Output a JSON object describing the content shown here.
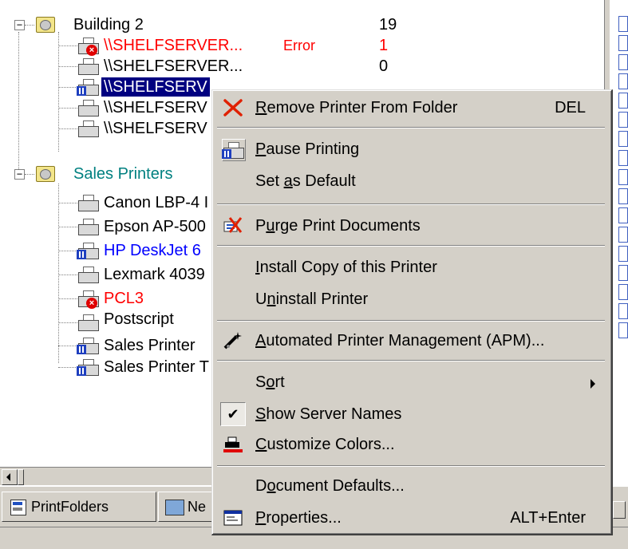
{
  "tree": {
    "building2": {
      "label": "Building 2",
      "count": "19"
    },
    "b2_items": [
      {
        "label": "\\\\SHELFSERVER...",
        "status": "Error",
        "count": "1"
      },
      {
        "label": "\\\\SHELFSERVER...",
        "status": "",
        "count": "0"
      },
      {
        "label": "\\\\SHELFSERV"
      },
      {
        "label": "\\\\SHELFSERV"
      },
      {
        "label": "\\\\SHELFSERV"
      }
    ],
    "sales_printers": {
      "label": "Sales Printers"
    },
    "sales_items": [
      {
        "label": "Canon LBP-4 I"
      },
      {
        "label": "Epson AP-500"
      },
      {
        "label": "HP DeskJet 6"
      },
      {
        "label": "Lexmark 4039"
      },
      {
        "label": "PCL3"
      },
      {
        "label": "Postscript"
      },
      {
        "label": "Sales Printer"
      },
      {
        "label": "Sales Printer T"
      }
    ]
  },
  "tabs": {
    "printfolders": "PrintFolders",
    "network": "Ne"
  },
  "menu": {
    "remove": {
      "pre": "",
      "acc": "R",
      "post": "emove Printer From Folder",
      "shortcut": "DEL"
    },
    "pause": {
      "pre": "",
      "acc": "P",
      "post": "ause Printing"
    },
    "setdefault": {
      "pre": "Set ",
      "acc": "a",
      "post": "s Default"
    },
    "purge": {
      "pre": "P",
      "acc": "u",
      "post": "rge Print Documents"
    },
    "install": {
      "pre": "",
      "acc": "I",
      "post": "nstall Copy of this Printer"
    },
    "uninstall": {
      "pre": "U",
      "acc": "n",
      "post": "install Printer"
    },
    "apm": {
      "pre": "",
      "acc": "A",
      "post": "utomated Printer Management (APM)..."
    },
    "sort": {
      "pre": "S",
      "acc": "o",
      "post": "rt"
    },
    "servernames": {
      "pre": "",
      "acc": "S",
      "post": "how Server Names",
      "checked": "✔"
    },
    "colors": {
      "pre": "",
      "acc": "C",
      "post": "ustomize Colors..."
    },
    "docdefaults": {
      "pre": "D",
      "acc": "o",
      "post": "cument Defaults..."
    },
    "properties": {
      "pre": "",
      "acc": "P",
      "post": "roperties...",
      "shortcut": "ALT+Enter"
    }
  },
  "colors": {
    "error_red": "#ff0000",
    "teal": "#008080",
    "blue": "#0000ff",
    "selection": "#000080"
  }
}
